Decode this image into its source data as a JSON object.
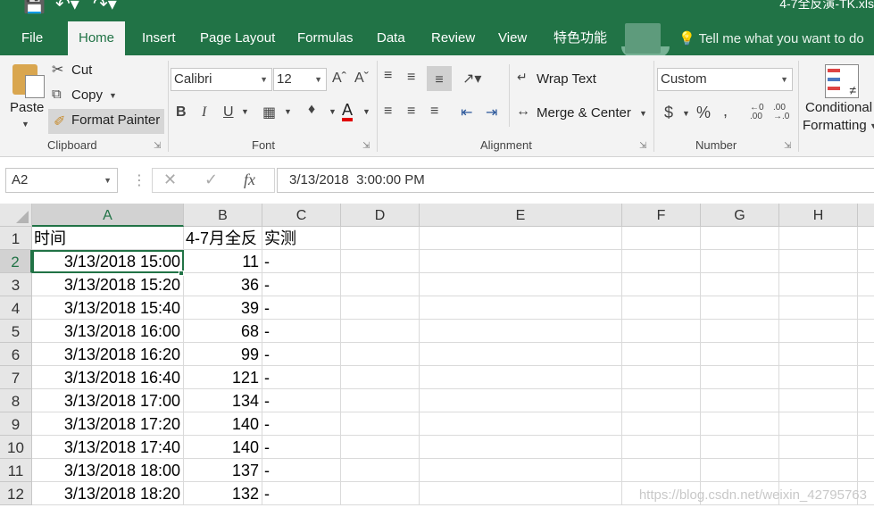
{
  "window": {
    "title": "4-7全反演-TK.xls"
  },
  "quick_access": {
    "save_icon": "save-icon",
    "undo_icon": "undo-icon",
    "redo_icon": "redo-icon"
  },
  "tabs": [
    {
      "label": "File",
      "active": false
    },
    {
      "label": "Home",
      "active": true
    },
    {
      "label": "Insert",
      "active": false
    },
    {
      "label": "Page Layout",
      "active": false
    },
    {
      "label": "Formulas",
      "active": false
    },
    {
      "label": "Data",
      "active": false
    },
    {
      "label": "Review",
      "active": false
    },
    {
      "label": "View",
      "active": false
    },
    {
      "label": "特色功能",
      "active": false
    }
  ],
  "tell_me": "Tell me what you want to do",
  "clipboard": {
    "paste": "Paste",
    "cut": "Cut",
    "copy": "Copy",
    "format_painter": "Format Painter",
    "group": "Clipboard"
  },
  "font": {
    "name": "Calibri",
    "size": "12",
    "group": "Font"
  },
  "alignment": {
    "wrap_text": "Wrap Text",
    "merge_center": "Merge & Center",
    "group": "Alignment"
  },
  "number": {
    "format": "Custom",
    "group": "Number"
  },
  "styles": {
    "conditional": "Conditional",
    "formatting": "Formatting"
  },
  "formula_bar": {
    "name_box": "A2",
    "fx": "fx",
    "value": "3/13/2018  3:00:00 PM"
  },
  "grid": {
    "columns": [
      "A",
      "B",
      "C",
      "D",
      "E",
      "F",
      "G",
      "H"
    ],
    "selected_column": "A",
    "rows": [
      {
        "num": "1",
        "a": "时间",
        "b": "4-7月全反",
        "c": "实测"
      },
      {
        "num": "2",
        "a": "3/13/2018 15:00",
        "b": "11",
        "c": "-"
      },
      {
        "num": "3",
        "a": "3/13/2018 15:20",
        "b": "36",
        "c": "-"
      },
      {
        "num": "4",
        "a": "3/13/2018 15:40",
        "b": "39",
        "c": "-"
      },
      {
        "num": "5",
        "a": "3/13/2018 16:00",
        "b": "68",
        "c": "-"
      },
      {
        "num": "6",
        "a": "3/13/2018 16:20",
        "b": "99",
        "c": "-"
      },
      {
        "num": "7",
        "a": "3/13/2018 16:40",
        "b": "121",
        "c": "-"
      },
      {
        "num": "8",
        "a": "3/13/2018 17:00",
        "b": "134",
        "c": "-"
      },
      {
        "num": "9",
        "a": "3/13/2018 17:20",
        "b": "140",
        "c": "-"
      },
      {
        "num": "10",
        "a": "3/13/2018 17:40",
        "b": "140",
        "c": "-"
      },
      {
        "num": "11",
        "a": "3/13/2018 18:00",
        "b": "137",
        "c": "-"
      },
      {
        "num": "12",
        "a": "3/13/2018 18:20",
        "b": "132",
        "c": "-"
      }
    ],
    "selected_row": "2"
  },
  "watermark": "https://blog.csdn.net/weixin_42795763",
  "colors": {
    "excel_green": "#217346",
    "ribbon_bg": "#f3f3f3"
  }
}
